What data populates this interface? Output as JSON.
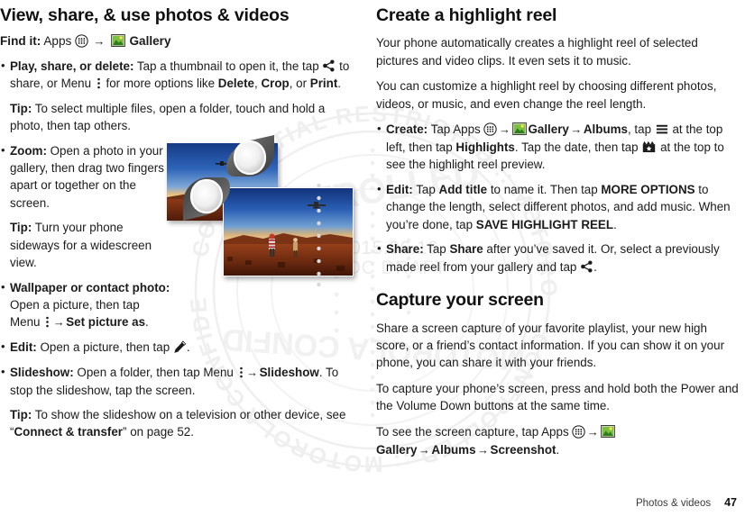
{
  "watermark": {
    "seal_text": "MOTOROLA CONFIDENTIAL RESTRICTED :: CONTROLLED",
    "date": "2015.06.16",
    "draft": "DOC DRAFT"
  },
  "left": {
    "heading": "View, share, & use photos & videos",
    "findit": {
      "label": "Find it:",
      "apps": "Apps",
      "gallery": "Gallery"
    },
    "bullets": [
      {
        "term": "Play, share, or delete:",
        "p1": " Tap a thumbnail to open it, the tap ",
        "p2": " to share, or Menu ",
        "p3": " for more options like ",
        "b1": "Delete",
        "sep1": ", ",
        "b2": "Crop",
        "p4": ", or ",
        "b3": "Print",
        "p5": "."
      },
      {
        "term": "Zoom:",
        "p1": " Open a photo in your gallery, then drag two fingers apart or together on the screen."
      },
      {
        "term": "Wallpaper or contact photo:",
        "p1": " Open a picture, then tap Menu ",
        "p2": " ",
        "b1": "Set picture as",
        "p3": "."
      },
      {
        "term": "Edit:",
        "p1": " Open a picture, then tap ",
        "p2": "."
      },
      {
        "term": "Slideshow:",
        "p1": " Open a folder, then tap Menu ",
        "p2": " ",
        "b1": "Slideshow",
        "p3": ". To stop the slideshow, tap the screen."
      }
    ],
    "tips": [
      {
        "label": "Tip:",
        "text": " To select multiple files, open a folder, touch and hold a photo, then tap others."
      },
      {
        "label": "Tip:",
        "text": " Turn your phone sideways for a widescreen view."
      },
      {
        "label": "Tip:",
        "pre": " To show the slideshow on a television or other device, see “",
        "bold": "Connect & transfer",
        "post": "” on page 52."
      }
    ]
  },
  "right": {
    "heading1": "Create a highlight reel",
    "para1": "Your phone automatically creates a highlight reel of selected pictures and video clips. It even sets it to music.",
    "para2": "You can customize a highlight reel by choosing different photos, videos, or music, and even change the reel length.",
    "bullets": [
      {
        "term": "Create:",
        "p1": " Tap Apps ",
        "b1": "Gallery",
        "b2": "Albums",
        "p2": ", tap ",
        "p3": " at the top left, then tap ",
        "b3": "Highlights",
        "p4": ". Tap the date, then tap ",
        "p5": " at the top to see the highlight reel preview."
      },
      {
        "term": "Edit:",
        "p1": " Tap ",
        "b1": "Add title",
        "p2": " to name it. Then tap ",
        "b2": "MORE OPTIONS",
        "p3": " to change the length, select different photos, and add music. When you’re done, tap ",
        "b3": "SAVE HIGHLIGHT REEL",
        "p4": "."
      },
      {
        "term": "Share:",
        "p1": " Tap ",
        "b1": "Share",
        "p2": " after you’ve saved it. Or, select a previously made reel from your gallery and tap ",
        "p3": "."
      }
    ],
    "heading2": "Capture your screen",
    "para3": "Share a screen capture of your favorite playlist, your new high score, or a friend’s contact information. If you can show it on your phone, you can share it with your friends.",
    "para4": "To capture your phone’s screen, press and hold both the Power and the Volume Down buttons at the same time.",
    "para5": {
      "p1": "To see the screen capture, tap Apps ",
      "b1": "Gallery",
      "b2": "Albums",
      "b3": "Screenshot",
      "p2": "."
    }
  },
  "footer": {
    "section": "Photos & videos",
    "page": "47"
  },
  "colors": {
    "text": "#1b1b1b",
    "watermark": "#eeeeee",
    "sky_top": "#1c3f8f",
    "sky_bottom": "#f3c67a",
    "ground": "#6b2410"
  },
  "arrow": "→"
}
